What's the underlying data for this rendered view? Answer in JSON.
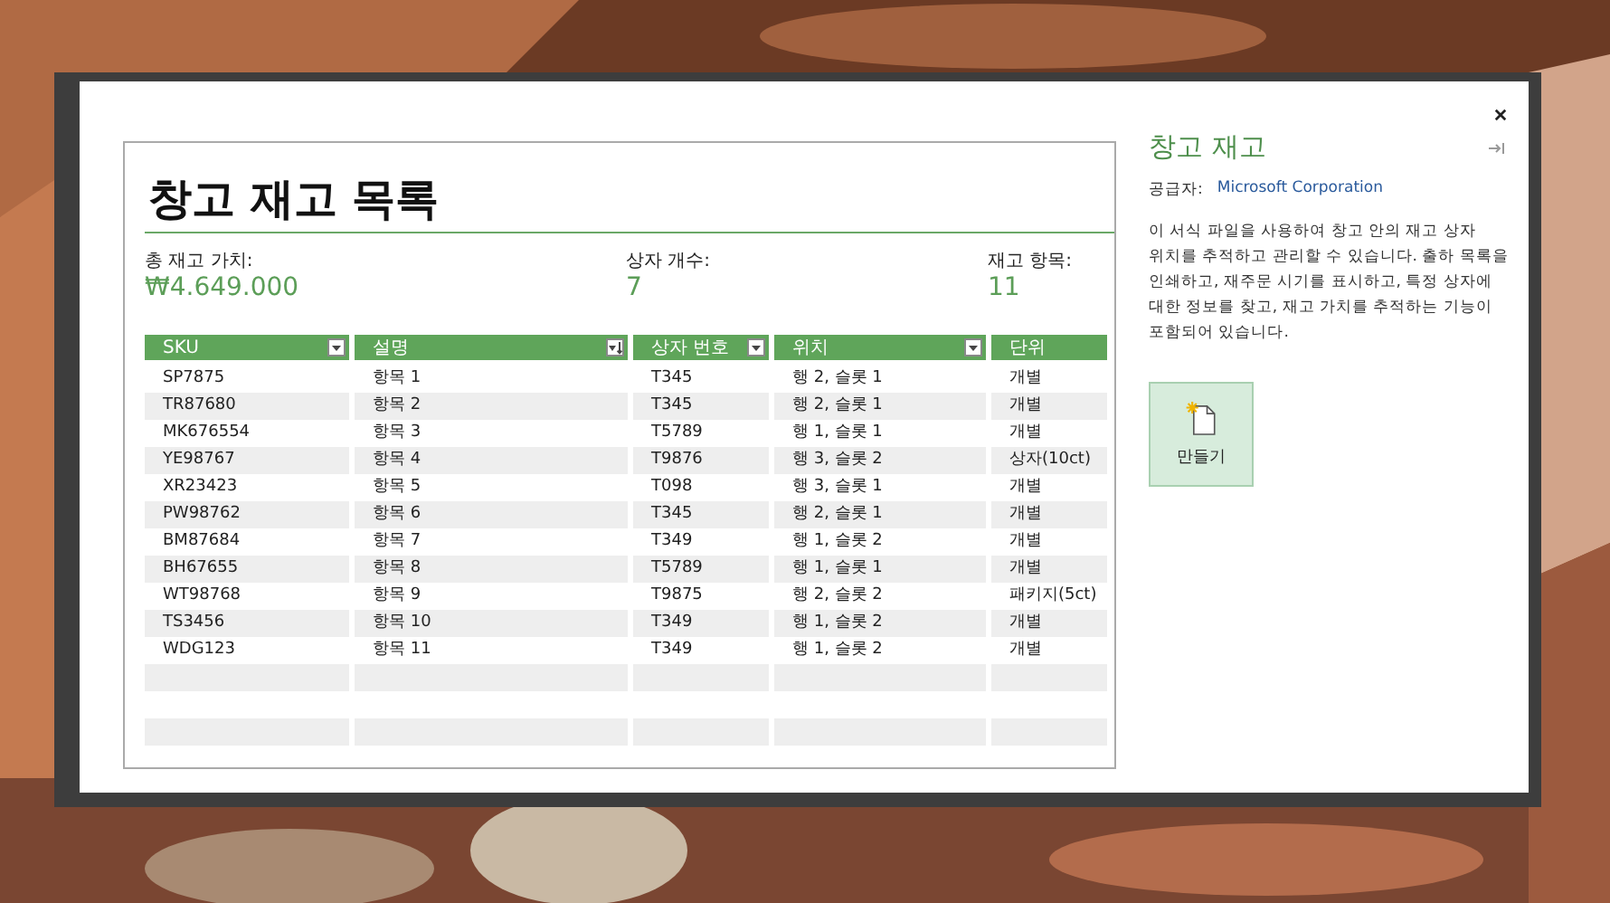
{
  "preview": {
    "title": "창고 재고 목록",
    "stats": [
      {
        "label": "총 재고 가치:",
        "value": "₩4.649.000"
      },
      {
        "label": "상자 개수:",
        "value": "7"
      },
      {
        "label": "재고 항목:",
        "value": "11"
      }
    ],
    "table": {
      "columns": [
        {
          "label": "SKU",
          "kind": "filter"
        },
        {
          "label": "설명",
          "kind": "sort"
        },
        {
          "label": "상자 번호",
          "kind": "filter"
        },
        {
          "label": "위치",
          "kind": "filter"
        },
        {
          "label": "단위",
          "kind": "plain"
        }
      ],
      "rows": [
        [
          "SP7875",
          "항목 1",
          "T345",
          "행 2, 슬롯 1",
          "개별"
        ],
        [
          "TR87680",
          "항목 2",
          "T345",
          "행 2, 슬롯 1",
          "개별"
        ],
        [
          "MK676554",
          "항목 3",
          "T5789",
          "행 1, 슬롯 1",
          "개별"
        ],
        [
          "YE98767",
          "항목 4",
          "T9876",
          "행 3, 슬롯 2",
          "상자(10ct)"
        ],
        [
          "XR23423",
          "항목 5",
          "T098",
          "행 3, 슬롯 1",
          "개별"
        ],
        [
          "PW98762",
          "항목 6",
          "T345",
          "행 2, 슬롯 1",
          "개별"
        ],
        [
          "BM87684",
          "항목 7",
          "T349",
          "행 1, 슬롯 2",
          "개별"
        ],
        [
          "BH67655",
          "항목 8",
          "T5789",
          "행 1, 슬롯 1",
          "개별"
        ],
        [
          "WT98768",
          "항목 9",
          "T9875",
          "행 2, 슬롯 2",
          "패키지(5ct)"
        ],
        [
          "TS3456",
          "항목 10",
          "T349",
          "행 1, 슬롯 2",
          "개별"
        ],
        [
          "WDG123",
          "항목 11",
          "T349",
          "행 1, 슬롯 2",
          "개별"
        ]
      ]
    }
  },
  "details": {
    "title": "창고 재고",
    "publisher_label": "공급자:",
    "publisher": "Microsoft Corporation",
    "description": "이 서식 파일을 사용하여 창고 안의 재고 상자 위치를 추적하고 관리할 수 있습니다. 출하 목록을 인쇄하고, 재주문 시기를 표시하고, 특정 상자에 대한 정보를 찾고, 재고 가치를 추적하는 기능이 포함되어 있습니다.",
    "create_button": "만들기"
  }
}
